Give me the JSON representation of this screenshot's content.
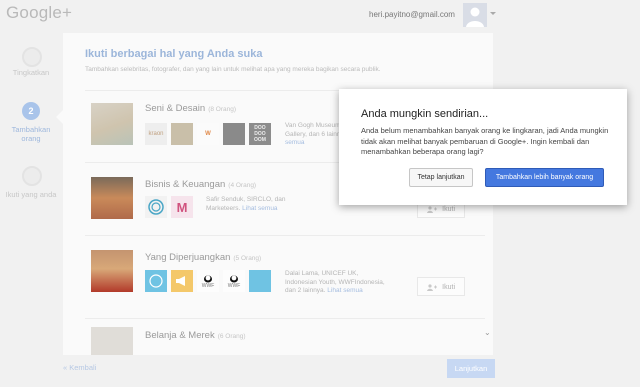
{
  "header": {
    "logo": "Google+",
    "email": "heri.payitno@gmail.com"
  },
  "steps": [
    {
      "label": "Tingkatkan"
    },
    {
      "number": "2",
      "label": "Tambahkan orang"
    },
    {
      "label": "Ikuti yang anda"
    }
  ],
  "panel": {
    "title": "Ikuti berbagai hal yang Anda suka",
    "subtitle": "Tambahkan selebritas, fotografer, dan yang lain untuk melihat apa yang mereka bagikan secara publik.",
    "categories": [
      {
        "title": "Seni & Desain",
        "count": "(8 Orang)",
        "thumbs": [
          "kraon",
          "",
          "W",
          "",
          "DOO DOO OOM"
        ],
        "desc": "Van Gogh Museum, Saatchi Gallery, dan 6 lainnya.",
        "link": "Lihat semua",
        "follow": "Ikuti"
      },
      {
        "title": "Bisnis & Keuangan",
        "count": "(4 Orang)",
        "thumbs": [
          "",
          "M"
        ],
        "desc": "Safir Senduk, SIRCLO, dan Marketeers.",
        "link": "Lihat semua",
        "follow": "Ikuti"
      },
      {
        "title": "Yang Diperjuangkan",
        "count": "(5 Orang)",
        "thumbs": [
          "",
          "",
          "WWF",
          "WWF",
          ""
        ],
        "desc": "Dalai Lama, UNICEF UK, Indonesian Youth, WWFIndonesia, dan 2 lainnya.",
        "link": "Lihat semua",
        "follow": "Ikuti"
      },
      {
        "title": "Belanja & Merek",
        "count": "(6 Orang)"
      }
    ]
  },
  "footer": {
    "back": "« Kembali",
    "next": "Lanjutkan"
  },
  "modal": {
    "title": "Anda mungkin sendirian...",
    "body": "Anda belum menambahkan banyak orang ke lingkaran, jadi Anda mungkin tidak akan melihat banyak pembaruan di Google+. Ingin kembali dan menambahkan beberapa orang lagi?",
    "secondary_label": "Tetap lanjutkan",
    "primary_label": "Tambahkan lebih banyak orang",
    "primary_color": "#4478df"
  }
}
